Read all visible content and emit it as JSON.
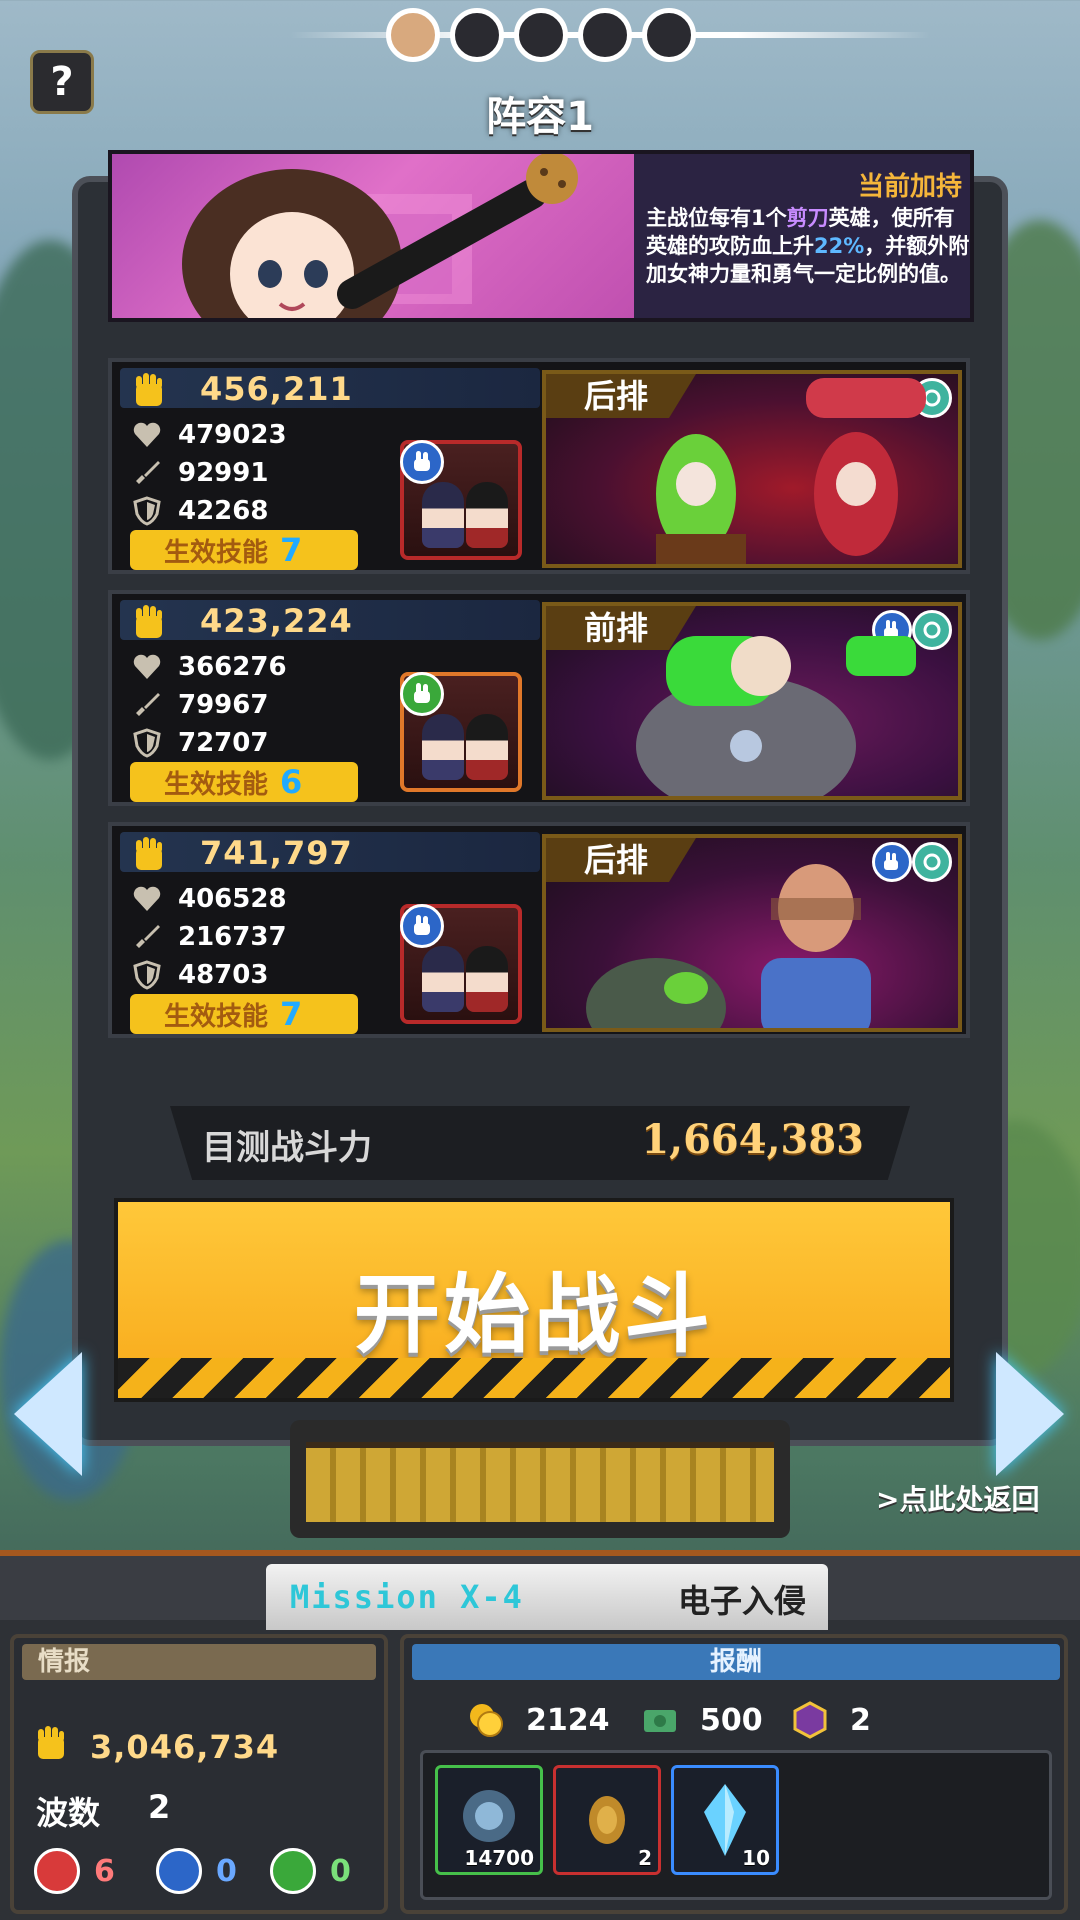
{
  "pager": {
    "total": 5,
    "active_index": 0
  },
  "help": {
    "label": "?"
  },
  "lineup": {
    "title": "阵容1"
  },
  "blessing": {
    "label": "当前加持",
    "desc_1": "主战位每有1个",
    "desc_type": "剪刀",
    "desc_2": "英雄，使所有英雄的攻防血上升",
    "desc_pct": "22%",
    "desc_3": "，并额外附加女神力量和勇气一定比例的值。"
  },
  "heroes": [
    {
      "power": "456,211",
      "hp": "479023",
      "atk": "92991",
      "def": "42268",
      "skill_label": "生效技能",
      "skill_count": "7",
      "position": "后排",
      "portrait_border": "red",
      "type_badge": "scissors-icon"
    },
    {
      "power": "423,224",
      "hp": "366276",
      "atk": "79967",
      "def": "72707",
      "skill_label": "生效技能",
      "skill_count": "6",
      "position": "前排",
      "portrait_border": "orange",
      "type_badge": "paper-icon"
    },
    {
      "power": "741,797",
      "hp": "406528",
      "atk": "216737",
      "def": "48703",
      "skill_label": "生效技能",
      "skill_count": "7",
      "position": "后排",
      "portrait_border": "red",
      "type_badge": "scissors-icon"
    }
  ],
  "combat": {
    "label": "目测战斗力",
    "value": "1,664,383"
  },
  "start": {
    "label": "开始战斗"
  },
  "nav": {
    "return_label": ">点此处返回",
    "prev_icon": "arrow-left-icon",
    "next_icon": "arrow-right-icon"
  },
  "mission": {
    "code": "Mission  X-4",
    "name": "电子入侵"
  },
  "intel": {
    "header": "情报",
    "power": "3,046,734",
    "waves_label": "波数",
    "waves_value": "2",
    "rock_count": "6",
    "scissors_count": "0",
    "paper_count": "0"
  },
  "rewards": {
    "header": "报酬",
    "gold": "2124",
    "cash": "500",
    "token": "2",
    "items": [
      {
        "count": "14700",
        "rarity": "green"
      },
      {
        "count": "2",
        "rarity": "red"
      },
      {
        "count": "10",
        "rarity": "blue"
      }
    ]
  },
  "colors": {
    "accent_gold": "#f5c21c",
    "power_text": "#ffd98a",
    "scissors_blue": "#2c66c8",
    "rock_red": "#d83a3a",
    "paper_green": "#3aa83a"
  }
}
